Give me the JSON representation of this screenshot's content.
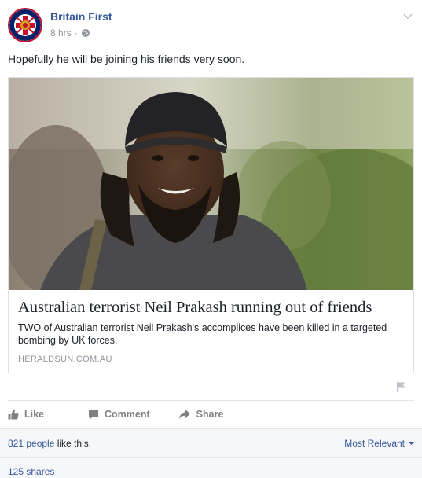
{
  "post": {
    "page_name": "Britain First",
    "time": "8 hrs",
    "separator": "·",
    "text": "Hopefully he will be joining his friends very soon."
  },
  "link_card": {
    "title": "Australian terrorist Neil Prakash running out of friends",
    "description": "TWO of Australian terrorist Neil Prakash's accomplices have been killed in a targeted bombing by UK forces.",
    "domain": "HERALDSUN.COM.AU"
  },
  "actions": {
    "like": "Like",
    "comment": "Comment",
    "share": "Share"
  },
  "footer": {
    "likes_link": "821 people",
    "likes_suffix": " like this.",
    "sort": "Most Relevant",
    "shares": "125 shares"
  },
  "colors": {
    "link_blue": "#365899",
    "meta_gray": "#90949c",
    "action_gray": "#7f7f7f",
    "footer_bg": "#f6f7f9",
    "logo_red": "#c8102e",
    "logo_blue": "#012169"
  },
  "icons": [
    "britain-first-logo",
    "globe-icon",
    "chevron-down-icon",
    "flag-icon",
    "like-icon",
    "comment-icon",
    "share-icon",
    "dropdown-triangle-icon"
  ]
}
